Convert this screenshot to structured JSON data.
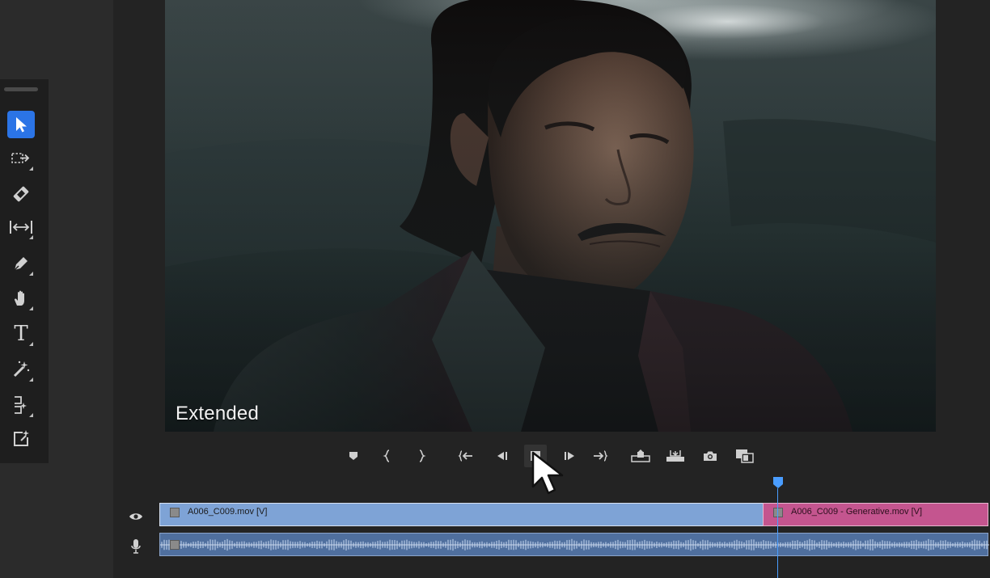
{
  "monitor": {
    "overlay_label": "Extended"
  },
  "tools": {
    "items": [
      {
        "name": "selection-tool",
        "icon": "arrow-pointer-icon",
        "active": true
      },
      {
        "name": "track-select-forward-tool",
        "icon": "track-select-icon",
        "active": false
      },
      {
        "name": "razor-tool",
        "icon": "razor-icon",
        "active": false
      },
      {
        "name": "slip-tool",
        "icon": "slip-icon",
        "active": false
      },
      {
        "name": "pen-tool",
        "icon": "pen-icon",
        "active": false
      },
      {
        "name": "hand-tool",
        "icon": "hand-icon",
        "active": false
      },
      {
        "name": "type-tool",
        "icon": "type-icon",
        "active": false,
        "glyph": "T"
      },
      {
        "name": "generative-extend-tool",
        "icon": "magic-wand-icon",
        "active": false
      },
      {
        "name": "remix-tool",
        "icon": "remix-icon",
        "active": false
      },
      {
        "name": "enhance-tool",
        "icon": "sparkle-frame-icon",
        "active": false
      }
    ]
  },
  "transport": {
    "buttons": [
      {
        "name": "add-marker-button",
        "icon": "marker-icon"
      },
      {
        "name": "mark-in-button",
        "icon": "mark-in-icon"
      },
      {
        "name": "mark-out-button",
        "icon": "mark-out-icon"
      },
      {
        "name": "go-to-in-button",
        "icon": "go-to-in-icon"
      },
      {
        "name": "step-back-button",
        "icon": "step-back-icon"
      },
      {
        "name": "stop-button",
        "icon": "stop-icon"
      },
      {
        "name": "step-forward-button",
        "icon": "step-forward-icon"
      },
      {
        "name": "go-to-out-button",
        "icon": "go-to-out-icon"
      },
      {
        "name": "lift-button",
        "icon": "lift-icon"
      },
      {
        "name": "extract-button",
        "icon": "extract-icon"
      },
      {
        "name": "export-frame-button",
        "icon": "camera-icon"
      },
      {
        "name": "comparison-view-button",
        "icon": "comparison-icon"
      }
    ]
  },
  "timeline": {
    "video_track_toggle_icon": "eye-icon",
    "audio_track_toggle_icon": "microphone-icon",
    "clips": {
      "clip1": "A006_C009.mov [V]",
      "clip2": "A006_C009 - Generative.mov [V]"
    }
  },
  "colors": {
    "accent": "#2b74e6",
    "clip_video": "#7ea3d6",
    "clip_generative": "#c4558f",
    "clip_audio": "#4f6f9e",
    "playhead": "#4a9dff"
  }
}
